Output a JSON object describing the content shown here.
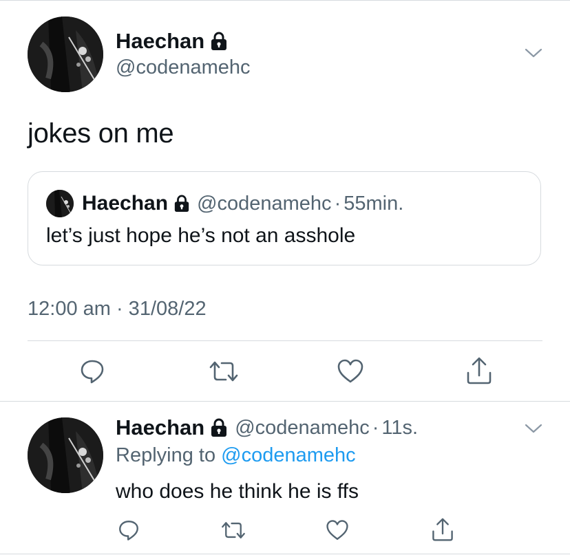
{
  "main_tweet": {
    "display_name": "Haechan",
    "handle": "@codenamehc",
    "text": "jokes on me",
    "timestamp": "12:00 am · 31/08/22"
  },
  "quoted_tweet": {
    "display_name": "Haechan",
    "handle": "@codenamehc",
    "separator": "·",
    "time": "55min.",
    "text": "let’s just hope he’s not an asshole"
  },
  "reply_tweet": {
    "display_name": "Haechan",
    "handle": "@codenamehc",
    "separator": "·",
    "time": "11s.",
    "replying_prefix": "Replying to",
    "replying_handle": "@codenamehc",
    "text": "who does he think he is ffs"
  },
  "colors": {
    "text": "#0f1419",
    "secondary": "#536471",
    "link": "#1d9bf0",
    "divider": "#d6dade"
  },
  "icons": [
    "lock-icon",
    "chevron-down-icon",
    "reply-icon",
    "retweet-icon",
    "like-icon",
    "share-icon"
  ]
}
